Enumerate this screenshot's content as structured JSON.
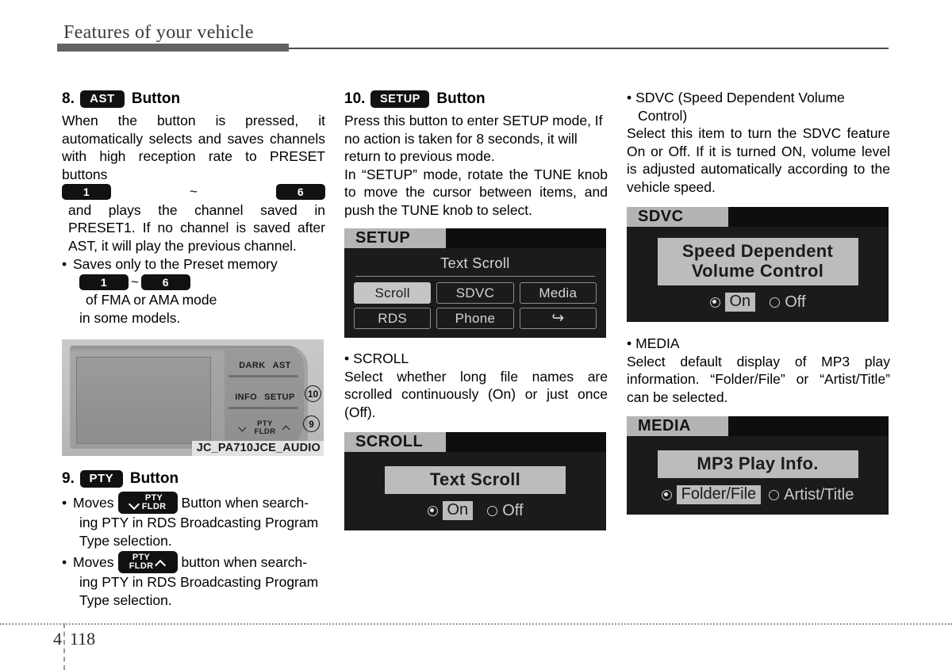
{
  "header": {
    "title": "Features of your vehicle"
  },
  "footer": {
    "chapter": "4",
    "page": "118"
  },
  "col1": {
    "sec8": {
      "num": "8.",
      "key": "AST",
      "word": "Button",
      "para1": "When the button is pressed, it automatically selects and saves channels with high reception rate to PRESET buttons",
      "preset_low": "1",
      "tilde": "~",
      "preset_high": "6",
      "para1_cont": "and plays the channel saved in PRESET1. If no channel is saved after AST, it will play the previous channel.",
      "bullet1_lead": "Saves only to the Preset memory",
      "bullet1_preset_low": "1",
      "bullet1_tilde": "~",
      "bullet1_preset_high": "6",
      "bullet1_tail": "of FMA or AMA mode",
      "bullet1_line3": "in some models.",
      "bullet_dot": "•"
    },
    "photo": {
      "dark_label": "DARK",
      "ast_label": "AST",
      "info_label": "INFO",
      "setup_label": "SETUP",
      "pty_label": "PTY",
      "fldr_label": "FLDR",
      "callout_10": "⑩",
      "callout_9": "⑨",
      "caption": "JC_PA710JCE_AUDIO"
    },
    "sec9": {
      "num": "9.",
      "key": "PTY",
      "word": "Button",
      "bullet_dot": "•",
      "b1_lead": "Moves",
      "b1_key_pty": "PTY",
      "b1_key_fldr": "FLDR",
      "b1_tail": "Button when search-",
      "b1_line2": "ing PTY in RDS Broadcasting Program",
      "b1_line3": "Type selection.",
      "b2_lead": "Moves",
      "b2_key_pty": "PTY",
      "b2_key_fldr": "FLDR",
      "b2_tail": "button when search-",
      "b2_line2": "ing PTY in RDS Broadcasting Program",
      "b2_line3": "Type selection."
    }
  },
  "col2": {
    "sec10": {
      "num": "10.",
      "key": "SETUP",
      "word": "Button",
      "para1": "Press this button to enter SETUP mode, If no action is taken for 8 seconds, it will return to previous mode.",
      "para2": "In “SETUP” mode, rotate the TUNE knob to move the cursor between items, and push the TUNE knob to select."
    },
    "setup_screen": {
      "tab": "SETUP",
      "title": "Text Scroll",
      "cells": [
        {
          "label": "Scroll",
          "selected": true
        },
        {
          "label": "SDVC",
          "selected": false
        },
        {
          "label": "Media",
          "selected": false
        },
        {
          "label": "RDS",
          "selected": false
        },
        {
          "label": "Phone",
          "selected": false
        },
        {
          "label": "↩",
          "selected": false
        }
      ]
    },
    "scroll": {
      "bullet_dot": "•",
      "heading": "SCROLL",
      "para": "Select whether long file names are scrolled continuously (On) or just once (Off)."
    },
    "scroll_screen": {
      "tab": "SCROLL",
      "option_title": "Text Scroll",
      "on_label": "On",
      "off_label": "Off",
      "selected": "On"
    }
  },
  "col3": {
    "sdvc": {
      "bullet_dot": "•",
      "heading_line1": "SDVC (Speed Dependent Volume",
      "heading_line2": "Control)",
      "para": "Select this item to turn the SDVC feature On or Off. If it is turned ON, volume level is adjusted automatically according to the vehicle speed."
    },
    "sdvc_screen": {
      "tab": "SDVC",
      "option_title_line1": "Speed Dependent",
      "option_title_line2": "Volume Control",
      "on_label": "On",
      "off_label": "Off",
      "selected": "On"
    },
    "media": {
      "bullet_dot": "•",
      "heading": "MEDIA",
      "para": "Select default display of MP3 play information. “Folder/File” or “Artist/Title” can be selected."
    },
    "media_screen": {
      "tab": "MEDIA",
      "option_title": "MP3 Play Info.",
      "on_label": "Folder/File",
      "off_label": "Artist/Title",
      "selected": "Folder/File"
    }
  }
}
